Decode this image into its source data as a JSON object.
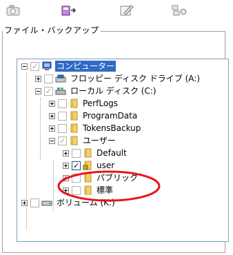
{
  "toolbar": {
    "buttons": [
      {
        "icon": "camera-icon"
      },
      {
        "icon": "backup-export-icon"
      },
      {
        "icon": "edit-document-icon"
      },
      {
        "icon": "network-settings-icon"
      }
    ]
  },
  "group": {
    "legend": "ファイル・バックアップ"
  },
  "tree": {
    "nodes": [
      {
        "label": "コンピューター",
        "checked": "grey",
        "icon": "computer-icon",
        "selected": true
      },
      {
        "label": "フロッピー ディスク ドライブ (A:)",
        "checked": "none",
        "icon": "floppy-drive-icon"
      },
      {
        "label": "ローカル ディスク (C:)",
        "checked": "grey",
        "icon": "local-disk-icon"
      },
      {
        "label": "PerfLogs",
        "checked": "none",
        "icon": "folder-icon"
      },
      {
        "label": "ProgramData",
        "checked": "none",
        "icon": "folder-icon"
      },
      {
        "label": "TokensBackup",
        "checked": "none",
        "icon": "folder-icon"
      },
      {
        "label": "ユーザー",
        "checked": "grey",
        "icon": "folder-icon"
      },
      {
        "label": "Default",
        "checked": "none",
        "icon": "folder-icon"
      },
      {
        "label": "user",
        "checked": "black",
        "icon": "locked-folder-icon"
      },
      {
        "label": "パブリック",
        "checked": "none",
        "icon": "folder-icon"
      },
      {
        "label": "標準",
        "checked": "none",
        "icon": "folder-icon"
      },
      {
        "label": "ボリューム (K:)",
        "checked": "none",
        "icon": "removable-drive-icon"
      }
    ]
  },
  "colors": {
    "selection": "#316ac5",
    "highlight_ring": "#e8141c",
    "folder": "#f2d36b"
  }
}
